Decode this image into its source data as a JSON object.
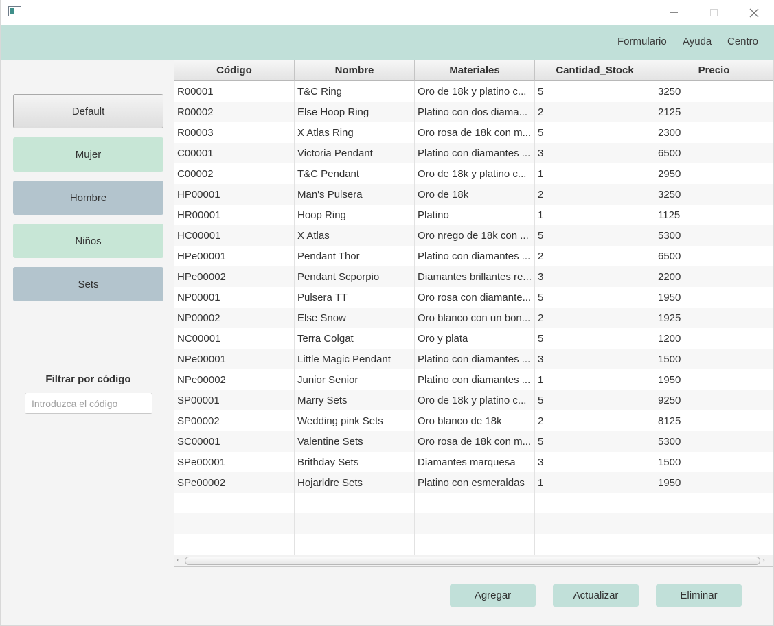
{
  "menubar": {
    "items": [
      {
        "label": "Formulario"
      },
      {
        "label": "Ayuda"
      },
      {
        "label": "Centro"
      }
    ]
  },
  "sidebar": {
    "categories": [
      {
        "label": "Default"
      },
      {
        "label": "Mujer"
      },
      {
        "label": "Hombre"
      },
      {
        "label": "Niños"
      },
      {
        "label": "Sets"
      }
    ],
    "filter": {
      "label": "Filtrar por código",
      "placeholder": "Introduzca el código",
      "value": ""
    }
  },
  "table": {
    "columns": [
      "Código",
      "Nombre",
      "Materiales",
      "Cantidad_Stock",
      "Precio"
    ],
    "rows": [
      [
        "R00001",
        "T&C Ring",
        "Oro de 18k y platino c...",
        "5",
        "3250"
      ],
      [
        "R00002",
        "Else Hoop Ring",
        "Platino con dos diama...",
        "2",
        "2125"
      ],
      [
        "R00003",
        "X Atlas Ring",
        "Oro rosa de 18k con m...",
        "5",
        "2300"
      ],
      [
        "C00001",
        "Victoria Pendant",
        "Platino con diamantes ...",
        "3",
        "6500"
      ],
      [
        "C00002",
        "T&C Pendant",
        "Oro de 18k y platino c...",
        "1",
        "2950"
      ],
      [
        "HP00001",
        "Man's Pulsera",
        "Oro de 18k",
        "2",
        "3250"
      ],
      [
        "HR00001",
        "Hoop Ring",
        "Platino",
        "1",
        "1125"
      ],
      [
        "HC00001",
        "X Atlas",
        "Oro nrego de 18k con ...",
        "5",
        "5300"
      ],
      [
        "HPe00001",
        "Pendant Thor",
        "Platino con diamantes ...",
        "2",
        "6500"
      ],
      [
        "HPe00002",
        "Pendant Scporpio",
        "Diamantes brillantes re...",
        "3",
        "2200"
      ],
      [
        "NP00001",
        "Pulsera TT",
        "Oro rosa con diamante...",
        "5",
        "1950"
      ],
      [
        "NP00002",
        "Else Snow",
        "Oro blanco con un bon...",
        "2",
        "1925"
      ],
      [
        "NC00001",
        "Terra Colgat",
        "Oro y plata",
        "5",
        "1200"
      ],
      [
        "NPe00001",
        "Little Magic Pendant",
        "Platino con diamantes ...",
        "3",
        "1500"
      ],
      [
        "NPe00002",
        "Junior Senior",
        "Platino con diamantes ...",
        "1",
        "1950"
      ],
      [
        "SP00001",
        "Marry Sets",
        "Oro de 18k y platino c...",
        "5",
        "9250"
      ],
      [
        "SP00002",
        "Wedding pink Sets",
        "Oro blanco de 18k",
        "2",
        "8125"
      ],
      [
        "SC00001",
        "Valentine Sets",
        "Oro rosa de 18k con m...",
        "5",
        "5300"
      ],
      [
        "SPe00001",
        "Brithday Sets",
        "Diamantes marquesa",
        "3",
        "1500"
      ],
      [
        "SPe00002",
        "Hojarldre Sets",
        "Platino con esmeraldas",
        "1",
        "1950"
      ],
      [
        "",
        "",
        "",
        "",
        ""
      ],
      [
        "",
        "",
        "",
        "",
        ""
      ],
      [
        "",
        "",
        "",
        "",
        ""
      ]
    ]
  },
  "actions": {
    "add_label": "Agregar",
    "update_label": "Actualizar",
    "delete_label": "Eliminar"
  },
  "colors": {
    "menubar_bg": "#c1e0d9",
    "green_button": "#c7e6d6",
    "blue_button": "#b3c4cd"
  }
}
